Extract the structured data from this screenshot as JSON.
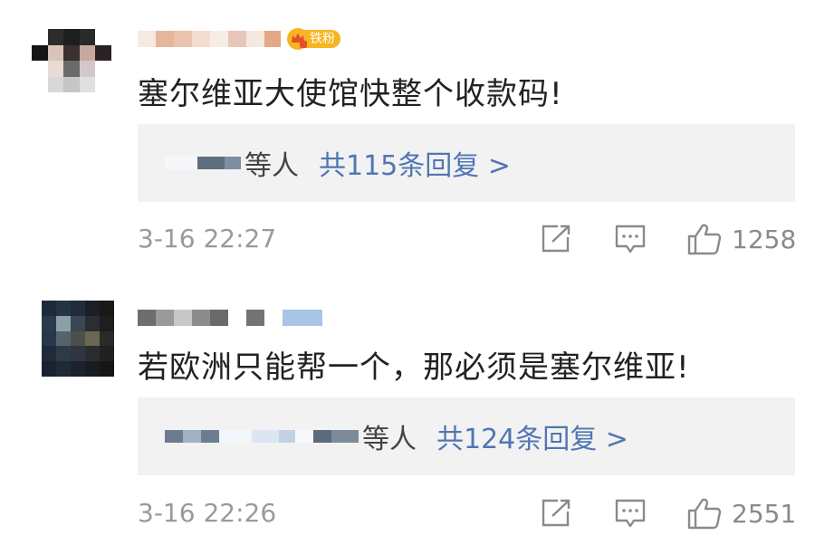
{
  "comments": [
    {
      "fan_badge": "铁粉",
      "text": "塞尔维亚大使馆快整个收款码!",
      "reply_suffix": "等人",
      "reply_count_label": "共115条回复 >",
      "timestamp": "3-16 22:27",
      "likes": "1258",
      "icons": {
        "share": "share-icon",
        "comment": "comment-icon",
        "like": "thumbs-up-icon"
      }
    },
    {
      "text": "若欧洲只能帮一个，那必须是塞尔维亚!",
      "reply_suffix": "等人",
      "reply_count_label": "共124条回复 >",
      "timestamp": "3-16 22:26",
      "likes": "2551",
      "icons": {
        "share": "share-icon",
        "comment": "comment-icon",
        "like": "thumbs-up-icon"
      }
    }
  ],
  "colors": {
    "text": "#222222",
    "link_blue": "#5076b4",
    "meta_gray": "#9a9a9a",
    "reply_bg": "#f2f2f2",
    "badge_gold": "#f7b521"
  }
}
